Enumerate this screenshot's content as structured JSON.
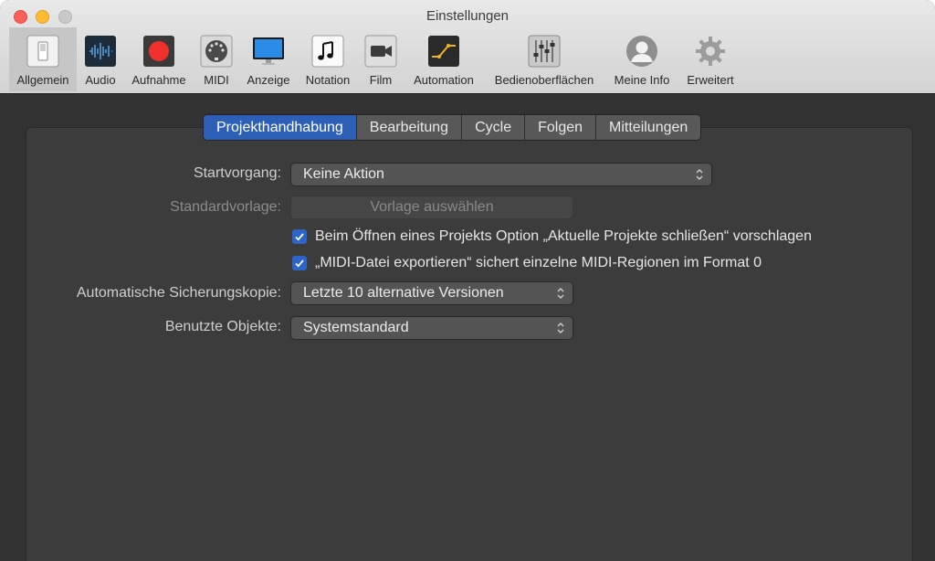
{
  "window": {
    "title": "Einstellungen"
  },
  "toolbar": {
    "items": [
      {
        "label": "Allgemein",
        "icon": "switch-icon",
        "selected": true
      },
      {
        "label": "Audio",
        "icon": "waveform-icon"
      },
      {
        "label": "Aufnahme",
        "icon": "record-icon"
      },
      {
        "label": "MIDI",
        "icon": "midi-connector-icon"
      },
      {
        "label": "Anzeige",
        "icon": "monitor-icon"
      },
      {
        "label": "Notation",
        "icon": "music-note-icon"
      },
      {
        "label": "Film",
        "icon": "camera-icon"
      },
      {
        "label": "Automation",
        "icon": "automation-curve-icon"
      },
      {
        "label": "Bedienoberflächen",
        "icon": "faders-icon"
      },
      {
        "label": "Meine Info",
        "icon": "user-icon"
      },
      {
        "label": "Erweitert",
        "icon": "gear-icon"
      }
    ]
  },
  "tabs": [
    {
      "label": "Projekthandhabung",
      "active": true
    },
    {
      "label": "Bearbeitung"
    },
    {
      "label": "Cycle"
    },
    {
      "label": "Folgen"
    },
    {
      "label": "Mitteilungen"
    }
  ],
  "settings": {
    "startvorgang": {
      "label": "Startvorgang:",
      "value": "Keine Aktion"
    },
    "standardvorlage": {
      "label": "Standardvorlage:",
      "button": "Vorlage auswählen"
    },
    "checkbox1": {
      "label": "Beim Öffnen eines Projekts Option „Aktuelle Projekte schließen“ vorschlagen",
      "checked": true
    },
    "checkbox2": {
      "label": "„MIDI-Datei exportieren“ sichert einzelne MIDI-Regionen im Format 0",
      "checked": true
    },
    "sicherung": {
      "label": "Automatische Sicherungskopie:",
      "value": "Letzte 10 alternative Versionen"
    },
    "objekte": {
      "label": "Benutzte Objekte:",
      "value": "Systemstandard"
    }
  },
  "colors": {
    "accent": "#2d5fb6",
    "background": "#323232",
    "titlebar": "#dcdcdc"
  }
}
